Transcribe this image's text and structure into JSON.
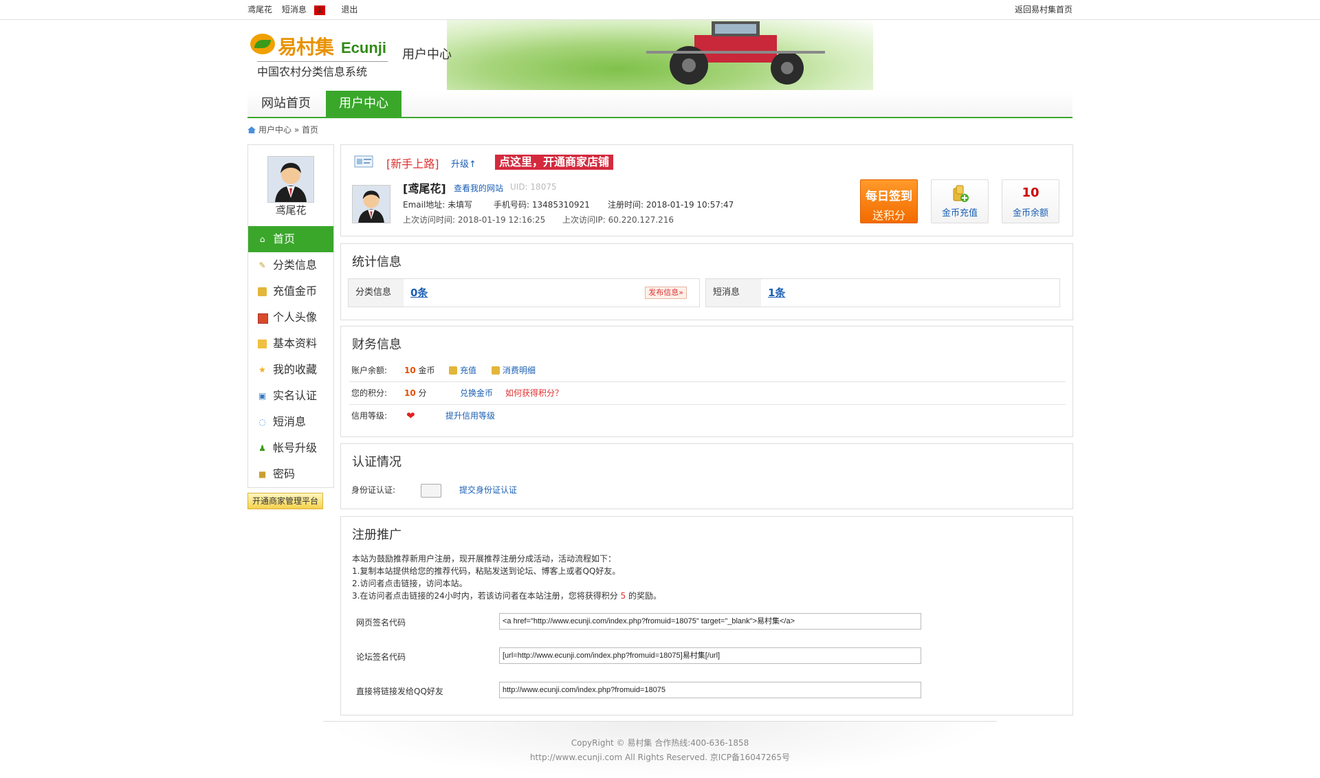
{
  "topbar": {
    "username": "鸢尾花",
    "messages_label": "短消息",
    "messages_count": "1",
    "logout": "退出",
    "back_home": "返回易村集首页"
  },
  "header": {
    "logo_cn": "易村集",
    "logo_en": "Ecunji",
    "logo_sub": "中国农村分类信息系统",
    "user_center": "用户中心"
  },
  "nav": {
    "items": [
      "网站首页",
      "用户中心"
    ],
    "active": "用户中心"
  },
  "breadcrumb": {
    "parent": "用户中心",
    "sep": "»",
    "current": "首页"
  },
  "sidebar": {
    "name": "鸢尾花",
    "items": [
      {
        "label": "首页",
        "icon": "home-icon"
      },
      {
        "label": "分类信息",
        "icon": "edit-icon"
      },
      {
        "label": "充值金币",
        "icon": "coins-icon"
      },
      {
        "label": "个人头像",
        "icon": "picture-icon"
      },
      {
        "label": "基本资料",
        "icon": "folder-icon"
      },
      {
        "label": "我的收藏",
        "icon": "star-icon"
      },
      {
        "label": "实名认证",
        "icon": "id-card-icon"
      },
      {
        "label": "短消息",
        "icon": "chat-icon"
      },
      {
        "label": "帐号升级",
        "icon": "user-up-icon"
      },
      {
        "label": "密码",
        "icon": "lock-icon"
      }
    ],
    "shop_button": "开通商家管理平台"
  },
  "profile": {
    "level": "[新手上路]",
    "upgrade": "升级↑",
    "open_shop": "点这里，开通商家店铺",
    "name": "[鸢尾花]",
    "view_site": "查看我的网站",
    "uid": "UID: 18075",
    "email": "Email地址: 未填写",
    "phone": "手机号码: 13485310921",
    "reg_time": "注册时间: 2018-01-19 10:57:47",
    "last_visit": "上次访问时间: 2018-01-19 12:16:25",
    "last_ip": "上次访问IP: 60.220.127.216",
    "sign_line1": "每日签到",
    "sign_line2": "送积分",
    "recharge": "金币充值",
    "balance_num": "10",
    "balance_label": "金币余额"
  },
  "stats": {
    "title": "统计信息",
    "classified_label": "分类信息",
    "classified_value": "0条",
    "publish": "发布信息»",
    "msg_label": "短消息",
    "msg_value": "1条"
  },
  "finance": {
    "title": "财务信息",
    "balance_label": "账户余额:",
    "balance_num": "10",
    "balance_unit": "金币",
    "recharge": "充值",
    "details": "消费明细",
    "points_label": "您的积分:",
    "points_num": "10",
    "points_unit": "分",
    "exchange": "兑换金币",
    "how_points": "如何获得积分？",
    "credit_label": "信用等级:",
    "credit_up": "提升信用等级"
  },
  "auth": {
    "title": "认证情况",
    "id_label": "身份证认证:",
    "submit_id": "提交身份证认证"
  },
  "promo": {
    "title": "注册推广",
    "line1": "本站为鼓励推荐新用户注册，现开展推荐注册分成活动，活动流程如下：",
    "line2": "1.复制本站提供给您的推荐代码，粘贴发送到论坛、博客上或者QQ好友。",
    "line3": "2.访问者点击链接，访问本站。",
    "line4_a": "3.在访问者点击链接的24小时内，若该访问者在本站注册，您将获得积分",
    "line4_num": "5",
    "line4_b": "的奖励。",
    "web_label": "网页签名代码",
    "web_code": "<a href=\"http://www.ecunji.com/index.php?fromuid=18075\" target=\"_blank\">易村集</a>",
    "forum_label": "论坛签名代码",
    "forum_code": "[url=http://www.ecunji.com/index.php?fromuid=18075]易村集[/url]",
    "qq_label": "直接将链接发给QQ好友",
    "qq_code": "http://www.ecunji.com/index.php?fromuid=18075"
  },
  "footer": {
    "line1": "CopyRight © 易村集 合作热线:400-636-1858",
    "line2": "http://www.ecunji.com All Rights Reserved. 京ICP备16047265号"
  },
  "colors": {
    "accent": "#3aa72b",
    "link": "#1a5fb4",
    "alert": "#d42a3e",
    "orange": "#f36b00"
  }
}
